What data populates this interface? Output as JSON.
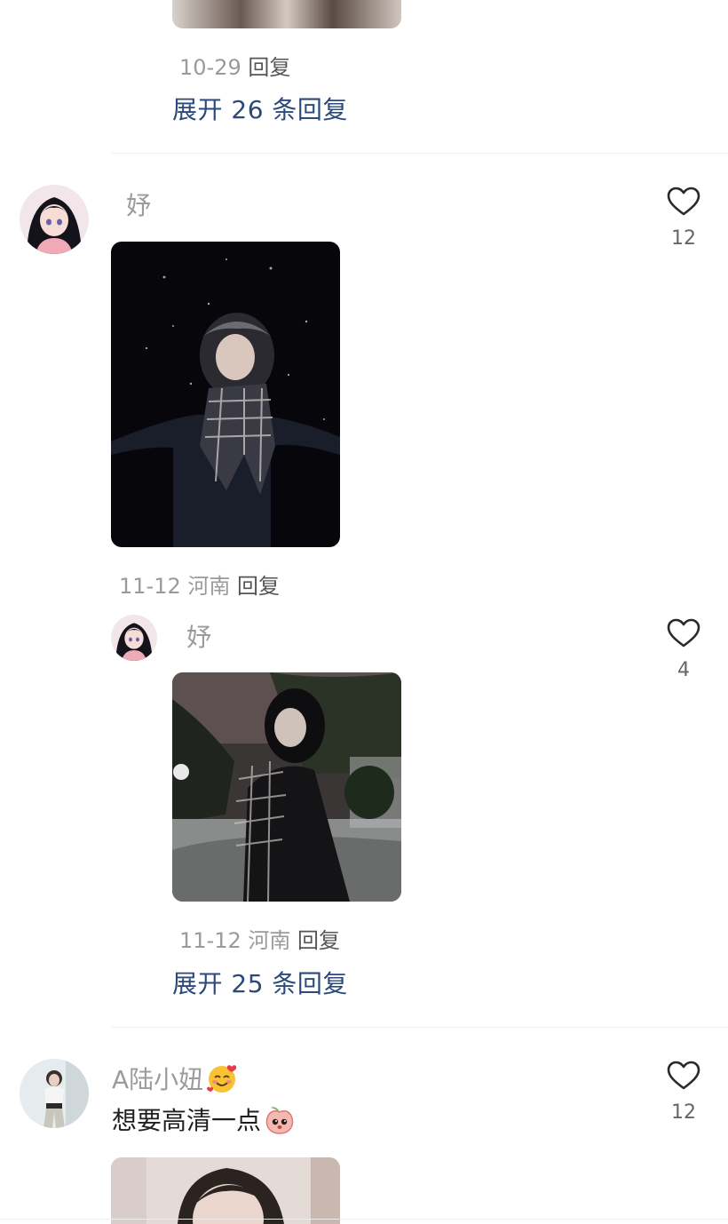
{
  "thread1": {
    "date": "10-29",
    "reply_label": "回复",
    "expand_label": "展开 26 条回复"
  },
  "comment1": {
    "username": "妤",
    "likes": "12",
    "date": "11-12",
    "location": "河南",
    "reply_label": "回复"
  },
  "reply1": {
    "username": "妤",
    "likes": "4",
    "date": "11-12",
    "location": "河南",
    "reply_label": "回复",
    "expand_label": "展开 25 条回复"
  },
  "comment2": {
    "username": "A陆小妞",
    "username_emoji": "smiling-face-with-hearts-emoji",
    "text": "想要高清一点",
    "text_emoji": "pleading-peach-sticker",
    "likes": "12"
  },
  "colors": {
    "link": "#2b4a79",
    "meta": "#9a9a9a",
    "divider": "#ececec"
  }
}
